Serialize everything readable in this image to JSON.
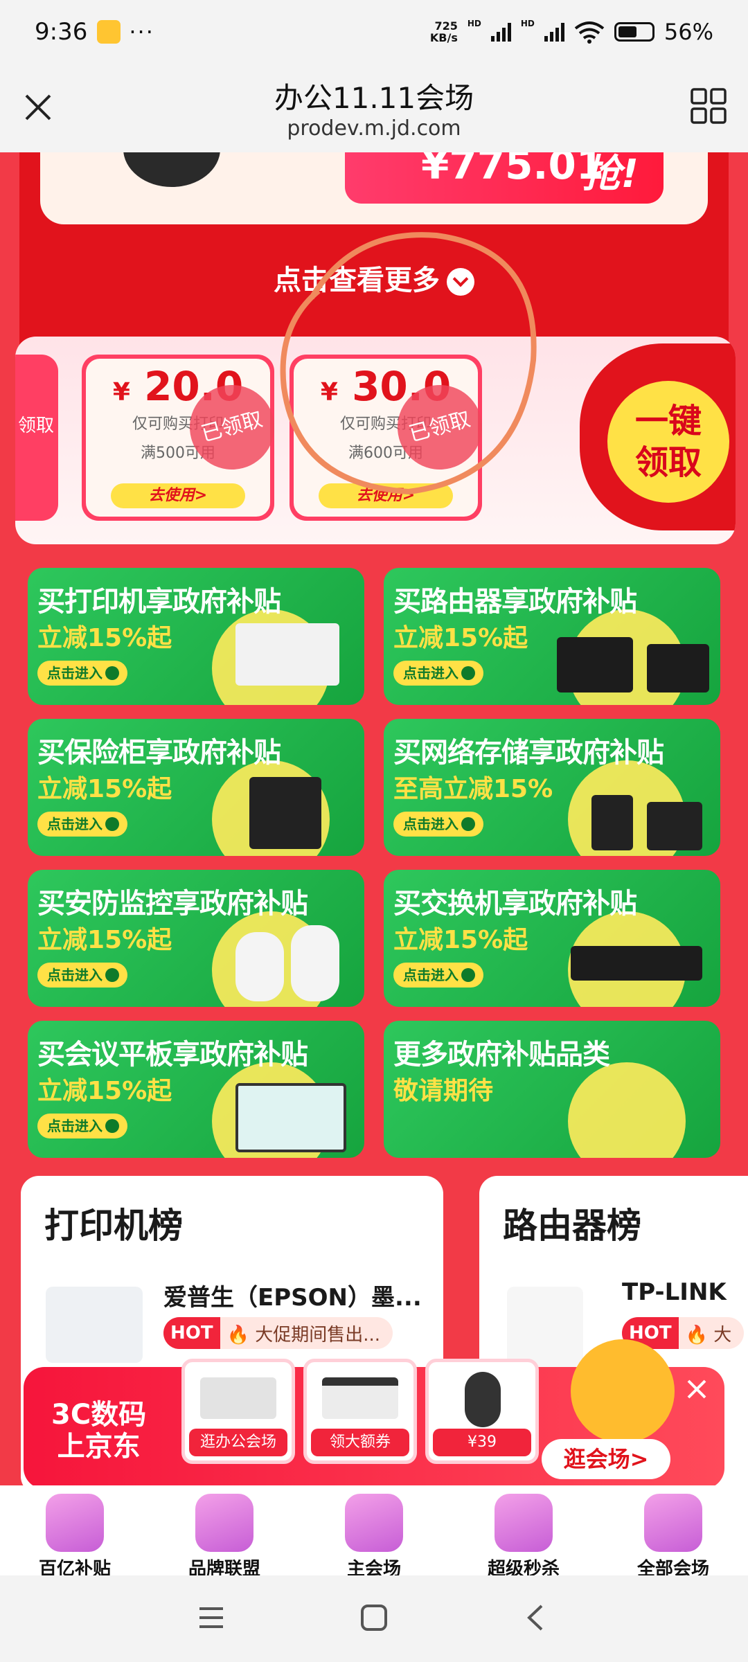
{
  "status_bar": {
    "time": "9:36",
    "dots": "···",
    "net_speed_value": "725",
    "net_speed_unit": "KB/s",
    "hd_1": "HD",
    "hd_2": "HD",
    "battery_percent": "56%"
  },
  "browser": {
    "title": "办公11.11会场",
    "url": "prodev.m.jd.com"
  },
  "promo_top": {
    "price": "¥775.01",
    "grab": "抢!",
    "see_more": "点击查看更多"
  },
  "coupons": {
    "partial_label": "领取",
    "items": [
      {
        "symbol": "¥",
        "amount": "20.0",
        "desc": "仅可购买打印",
        "condition": "满500可用",
        "stamp": "已领取",
        "use_label": "去使用>"
      },
      {
        "symbol": "¥",
        "amount": "30.0",
        "desc": "仅可购买打印",
        "condition": "满600可用",
        "stamp": "已领取",
        "use_label": "去使用>"
      }
    ],
    "one_click_line1": "一键",
    "one_click_line2": "领取"
  },
  "subsidies": [
    {
      "title": "买打印机享政府补贴",
      "subtitle": "立减15%起",
      "enter": "点击进入"
    },
    {
      "title": "买路由器享政府补贴",
      "subtitle": "立减15%起",
      "enter": "点击进入"
    },
    {
      "title": "买保险柜享政府补贴",
      "subtitle": "立减15%起",
      "enter": "点击进入"
    },
    {
      "title": "买网络存储享政府补贴",
      "subtitle": "至高立减15%",
      "enter": "点击进入"
    },
    {
      "title": "买安防监控享政府补贴",
      "subtitle": "立减15%起",
      "enter": "点击进入"
    },
    {
      "title": "买交换机享政府补贴",
      "subtitle": "立减15%起",
      "enter": "点击进入"
    },
    {
      "title": "买会议平板享政府补贴",
      "subtitle": "立减15%起",
      "enter": "点击进入"
    },
    {
      "title": "更多政府补贴品类",
      "subtitle": "敬请期待",
      "enter": ""
    }
  ],
  "rankings": {
    "printer": {
      "title": "打印机榜",
      "item_name": "爱普生（EPSON）墨...",
      "hot": "HOT",
      "hot_text": "🔥 大促期间售出..."
    },
    "router": {
      "title": "路由器榜",
      "item_name": "TP-LINK",
      "hot": "HOT",
      "hot_text": "🔥 大"
    }
  },
  "float_banner": {
    "left_line1": "3C数码",
    "left_line2": "上京东",
    "products": [
      {
        "label": "逛办公会场"
      },
      {
        "label": "领大额券"
      },
      {
        "label": "¥39"
      }
    ],
    "cta": "逛会场>"
  },
  "tabs": [
    {
      "label": "百亿补贴",
      "icon": "bag-icon"
    },
    {
      "label": "品牌联盟",
      "icon": "trophy-icon"
    },
    {
      "label": "主会场",
      "icon": "1111-icon"
    },
    {
      "label": "超级秒杀",
      "icon": "alarm-icon"
    },
    {
      "label": "全部会场",
      "icon": "grid-icon"
    }
  ],
  "colors": {
    "page_bg": "#f23a47",
    "jd_red": "#e1131c",
    "subsidy_green": "#1fb84b",
    "coupon_yellow": "#ffe146",
    "tab_purple": "#c75ed6"
  }
}
